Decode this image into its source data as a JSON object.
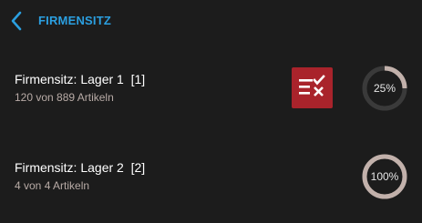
{
  "header": {
    "title": "FIRMENSITZ"
  },
  "colors": {
    "background": "#1c1c1c",
    "accent": "#2b9fe0",
    "action_button": "#a9232b",
    "progress_track": "#3a3a3a",
    "progress_fill": "#c2b1ab",
    "subtitle": "#b8aba6"
  },
  "items": [
    {
      "title": "Firmensitz: Lager 1  [1]",
      "subtitle": "120 von 889 Artikeln",
      "progress_label": "25%",
      "progress": 0.25,
      "action_icon": "checklist-cancel-icon"
    },
    {
      "title": "Firmensitz: Lager 2  [2]",
      "subtitle": "4 von 4 Artikeln",
      "progress_label": "100%",
      "progress": 1.0
    }
  ]
}
